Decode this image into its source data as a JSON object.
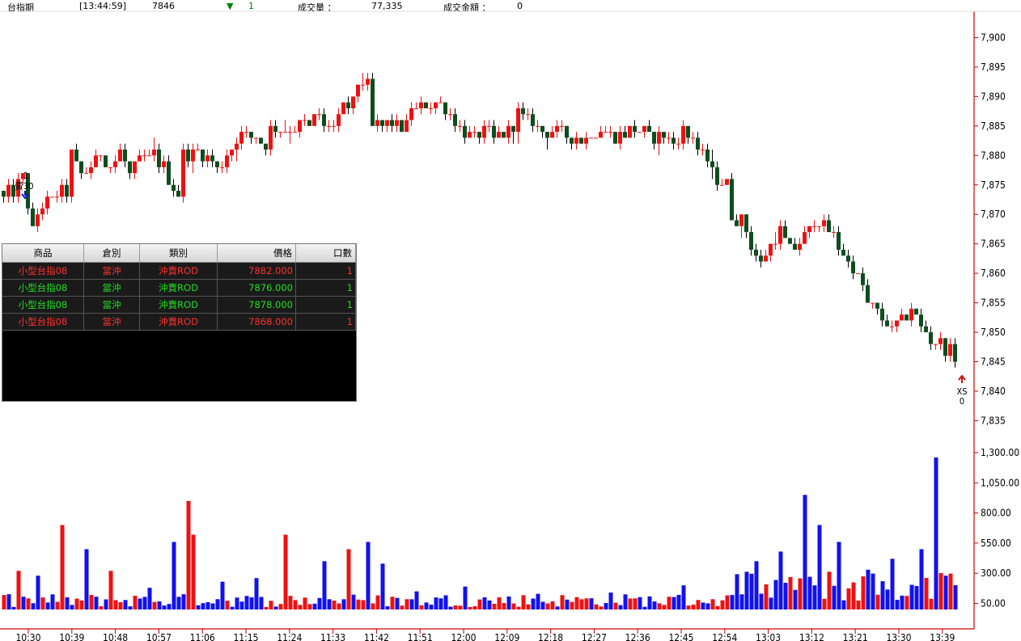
{
  "header": {
    "symbol": "台指期",
    "time": "[13:44:59]",
    "price": "7846",
    "change_arrow": "▼",
    "change": "1",
    "volume_label": "成交量 ：",
    "volume": "77,335",
    "amount_label": "成交金額 ：",
    "amount": "0"
  },
  "colors": {
    "up": "#ee1111",
    "down": "#0d4d1d",
    "vol_up": "#ee1111",
    "vol_down": "#1111ee",
    "axis": "#cc0000"
  },
  "chart_data": [
    {
      "type": "candlestick",
      "title": "",
      "ylim": [
        7833,
        7905
      ],
      "y_ticks": [
        "7,900",
        "7,895",
        "7,890",
        "7,885",
        "7,880",
        "7,875",
        "7,870",
        "7,865",
        "7,860",
        "7,855",
        "7,850",
        "7,845",
        "7,840",
        "7,835"
      ],
      "y_tick_values": [
        7900,
        7895,
        7890,
        7885,
        7880,
        7875,
        7870,
        7865,
        7860,
        7855,
        7850,
        7845,
        7840,
        7835
      ],
      "x_ticks": [
        "10:30",
        "10:39",
        "10:48",
        "10:57",
        "11:06",
        "11:15",
        "11:24",
        "11:33",
        "11:42",
        "11:51",
        "12:00",
        "12:09",
        "12:18",
        "12:27",
        "12:36",
        "12:45",
        "12:54",
        "13:03",
        "13:12",
        "13:21",
        "13:30",
        "13:39"
      ],
      "close_path": [
        [
          0,
          7873
        ],
        [
          2,
          7874
        ],
        [
          4,
          7876
        ],
        [
          5,
          7872
        ],
        [
          6,
          7867
        ],
        [
          7,
          7870
        ],
        [
          9,
          7872
        ],
        [
          11,
          7873
        ],
        [
          13,
          7874
        ],
        [
          14,
          7880
        ],
        [
          16,
          7877
        ],
        [
          18,
          7878
        ],
        [
          20,
          7881
        ],
        [
          22,
          7878
        ],
        [
          24,
          7881
        ],
        [
          26,
          7877
        ],
        [
          28,
          7879
        ],
        [
          31,
          7880
        ],
        [
          33,
          7878
        ],
        [
          36,
          7873
        ],
        [
          37,
          7880
        ],
        [
          40,
          7881
        ],
        [
          42,
          7880
        ],
        [
          44,
          7878
        ],
        [
          47,
          7881
        ],
        [
          49,
          7884
        ],
        [
          52,
          7883
        ],
        [
          54,
          7882
        ],
        [
          55,
          7885
        ],
        [
          57,
          7884
        ],
        [
          59,
          7885
        ],
        [
          63,
          7885
        ],
        [
          65,
          7887
        ],
        [
          66,
          7885
        ],
        [
          68,
          7885
        ],
        [
          70,
          7888
        ],
        [
          72,
          7889
        ],
        [
          73,
          7892
        ],
        [
          75,
          7892
        ],
        [
          76,
          7885
        ],
        [
          80,
          7885
        ],
        [
          83,
          7885
        ],
        [
          84,
          7888
        ],
        [
          86,
          7888
        ],
        [
          89,
          7889
        ],
        [
          91,
          7888
        ],
        [
          94,
          7885
        ],
        [
          96,
          7883
        ],
        [
          99,
          7884
        ],
        [
          101,
          7883
        ],
        [
          103,
          7884
        ],
        [
          105,
          7885
        ],
        [
          106,
          7887
        ],
        [
          108,
          7886
        ],
        [
          110,
          7885
        ],
        [
          111,
          7884
        ],
        [
          114,
          7884
        ],
        [
          116,
          7883
        ],
        [
          120,
          7883
        ],
        [
          122,
          7884
        ],
        [
          124,
          7884
        ],
        [
          126,
          7883
        ],
        [
          128,
          7884
        ],
        [
          131,
          7884
        ],
        [
          134,
          7883
        ],
        [
          136,
          7883
        ],
        [
          138,
          7882
        ],
        [
          140,
          7884
        ],
        [
          142,
          7883
        ],
        [
          143,
          7881
        ],
        [
          145,
          7879
        ],
        [
          147,
          7876
        ],
        [
          149,
          7875
        ],
        [
          150,
          7870
        ],
        [
          152,
          7869
        ],
        [
          154,
          7865
        ],
        [
          156,
          7862
        ],
        [
          158,
          7865
        ],
        [
          160,
          7867
        ],
        [
          162,
          7864
        ],
        [
          165,
          7866
        ],
        [
          167,
          7869
        ],
        [
          169,
          7868
        ],
        [
          171,
          7866
        ],
        [
          172,
          7864
        ],
        [
          174,
          7862
        ],
        [
          177,
          7858
        ],
        [
          178,
          7855
        ],
        [
          180,
          7853
        ],
        [
          182,
          7852
        ],
        [
          183,
          7850
        ],
        [
          185,
          7852
        ],
        [
          187,
          7854
        ],
        [
          189,
          7851
        ],
        [
          191,
          7849
        ],
        [
          193,
          7848
        ],
        [
          195,
          7847
        ],
        [
          196,
          7846
        ]
      ],
      "open_close_labels": [
        "1",
        "賣30"
      ],
      "end_labels": [
        "XS",
        "0"
      ]
    },
    {
      "type": "bar",
      "title": "",
      "ylim": [
        0,
        1300
      ],
      "y_ticks": [
        "1,300.00",
        "1,050.00",
        "800.00",
        "550.00",
        "300.00",
        "50.00"
      ],
      "y_tick_values": [
        1300,
        1050,
        800,
        550,
        300,
        50
      ],
      "spike_path": [
        [
          0,
          120
        ],
        [
          3,
          320
        ],
        [
          7,
          280
        ],
        [
          12,
          700
        ],
        [
          17,
          500
        ],
        [
          22,
          320
        ],
        [
          30,
          180
        ],
        [
          35,
          560
        ],
        [
          38,
          900
        ],
        [
          39,
          620
        ],
        [
          45,
          230
        ],
        [
          52,
          260
        ],
        [
          58,
          620
        ],
        [
          66,
          400
        ],
        [
          71,
          500
        ],
        [
          75,
          560
        ],
        [
          78,
          380
        ],
        [
          85,
          150
        ],
        [
          95,
          190
        ],
        [
          110,
          130
        ],
        [
          125,
          140
        ],
        [
          140,
          200
        ],
        [
          150,
          120
        ],
        [
          155,
          400
        ],
        [
          160,
          480
        ],
        [
          165,
          950
        ],
        [
          168,
          700
        ],
        [
          172,
          560
        ],
        [
          178,
          330
        ],
        [
          183,
          420
        ],
        [
          189,
          500
        ],
        [
          192,
          1260
        ],
        [
          198,
          600
        ],
        [
          201,
          1080
        ],
        [
          204,
          650
        ],
        [
          210,
          480
        ],
        [
          215,
          700
        ],
        [
          220,
          1000
        ]
      ],
      "spike_colors": [
        "r",
        "r",
        "b",
        "r",
        "b",
        "r",
        "b",
        "b",
        "r",
        "r",
        "b",
        "b",
        "r",
        "b",
        "r",
        "b",
        "b",
        "b",
        "b",
        "b",
        "b",
        "b",
        "b",
        "b",
        "b",
        "b",
        "b",
        "b",
        "b",
        "b",
        "b",
        "b",
        "r",
        "r",
        "b",
        "b",
        "b",
        "r"
      ]
    }
  ],
  "trades": {
    "columns": [
      "商品",
      "倉別",
      "類別",
      "價格",
      "口數"
    ],
    "rows": [
      {
        "product": "小型台指08",
        "position": "當沖",
        "type": "沖賣ROD",
        "price": "7882.000",
        "qty": "1",
        "side": "red"
      },
      {
        "product": "小型台指08",
        "position": "當沖",
        "type": "沖賣ROD",
        "price": "7876.000",
        "qty": "1",
        "side": "green"
      },
      {
        "product": "小型台指08",
        "position": "當沖",
        "type": "沖賣ROD",
        "price": "7878.000",
        "qty": "1",
        "side": "green"
      },
      {
        "product": "小型台指08",
        "position": "當沖",
        "type": "沖賣ROD",
        "price": "7868.000",
        "qty": "1",
        "side": "red"
      }
    ]
  }
}
